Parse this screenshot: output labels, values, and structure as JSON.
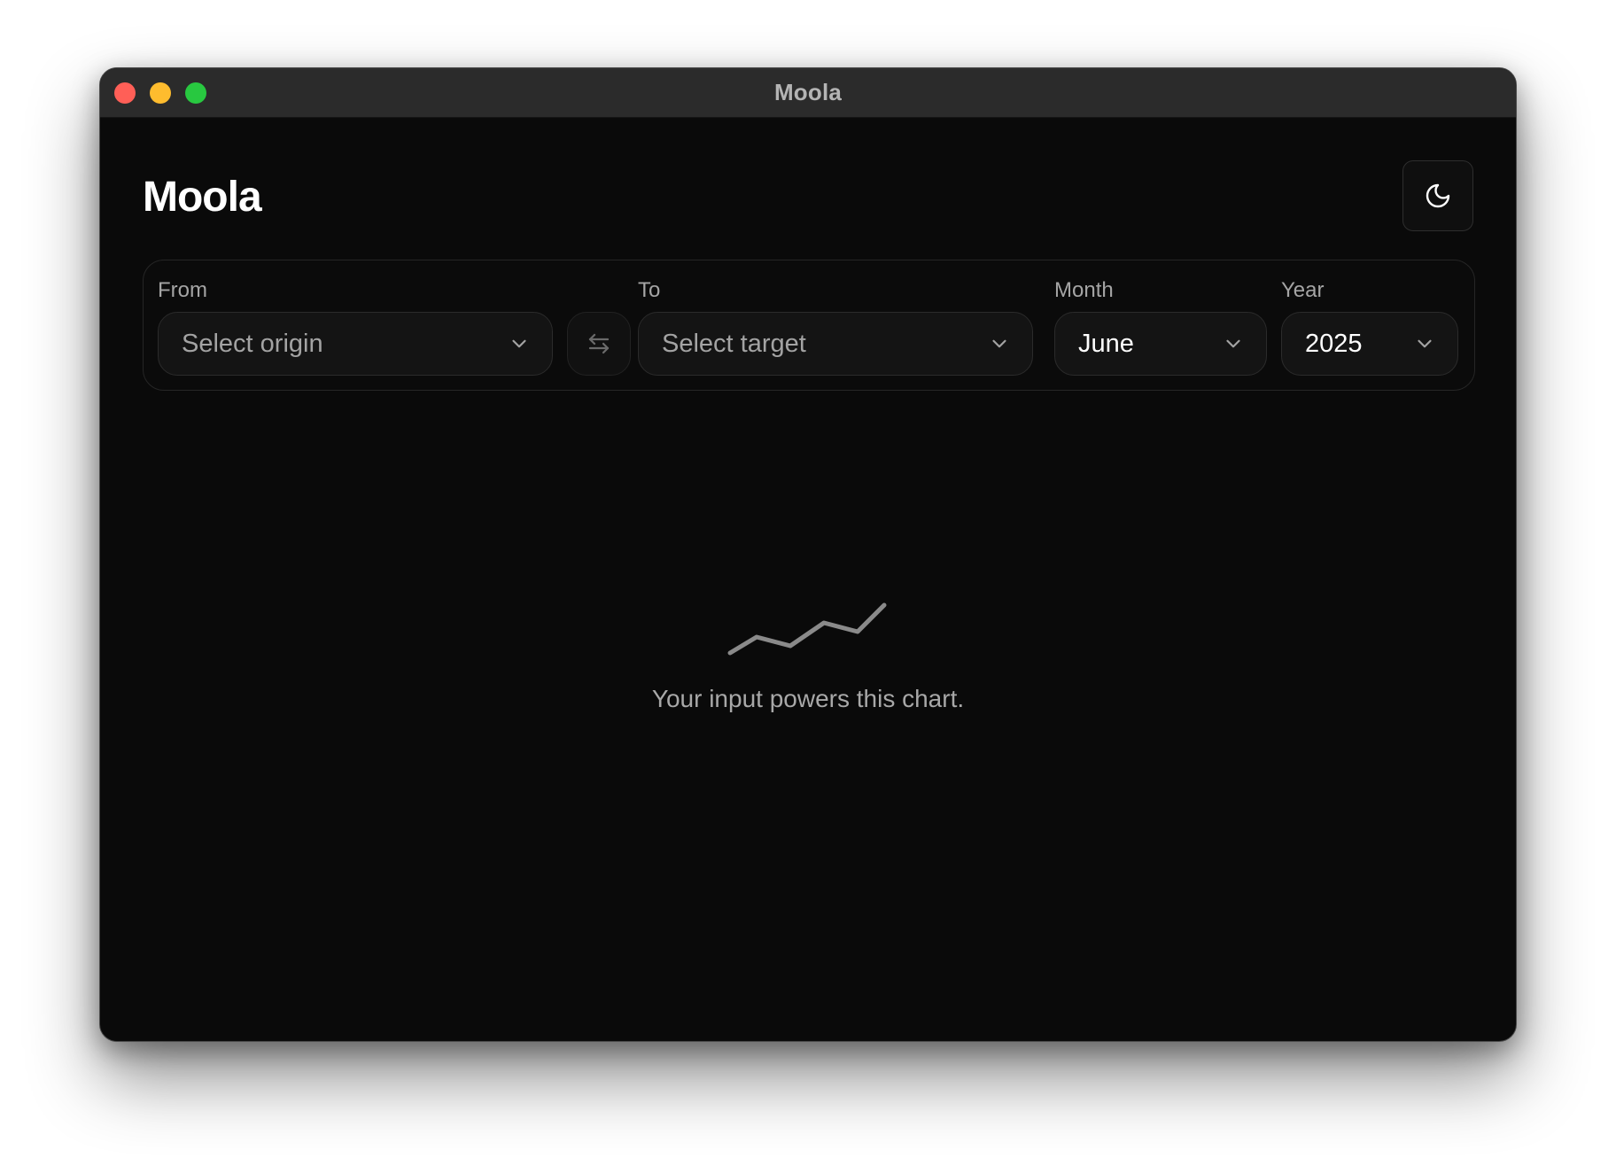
{
  "window": {
    "title": "Moola"
  },
  "header": {
    "app_title": "Moola",
    "theme_toggle_icon": "moon-icon"
  },
  "filters": {
    "from": {
      "label": "From",
      "placeholder": "Select origin",
      "value": ""
    },
    "swap_icon": "swap-arrows-icon",
    "to": {
      "label": "To",
      "placeholder": "Select target",
      "value": ""
    },
    "month": {
      "label": "Month",
      "value": "June"
    },
    "year": {
      "label": "Year",
      "value": "2025"
    }
  },
  "empty_state": {
    "icon": "line-chart-icon",
    "message": "Your input powers this chart."
  },
  "colors": {
    "background": "#0a0a0a",
    "titlebar": "#2b2b2b",
    "close": "#ff5f57",
    "minimize": "#febc2e",
    "maximize": "#28c840",
    "muted_text": "#a8a8a8"
  }
}
